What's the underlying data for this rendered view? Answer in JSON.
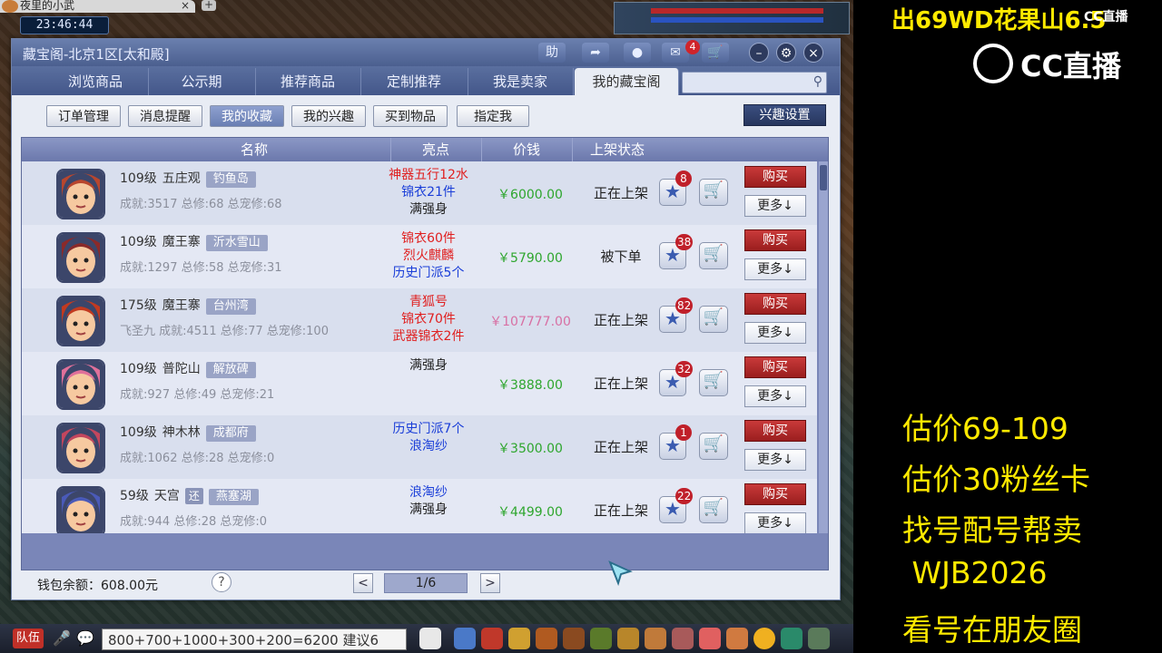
{
  "browser_tab": {
    "title": "夜里的小武",
    "close": "×",
    "new_tab": "+"
  },
  "clock": "23:46:44",
  "window": {
    "title": "藏宝阁-北京1区[太和殿]",
    "help_label": "助",
    "mail_badge": "4",
    "controls": {
      "minimize": "–",
      "settings": "⚙",
      "close": "×"
    }
  },
  "tabs": [
    {
      "label": "浏览商品",
      "active": false
    },
    {
      "label": "公示期",
      "active": false
    },
    {
      "label": "推荐商品",
      "active": false
    },
    {
      "label": "定制推荐",
      "active": false
    },
    {
      "label": "我是卖家",
      "active": false
    },
    {
      "label": "我的藏宝阁",
      "active": true
    }
  ],
  "sub_buttons": [
    {
      "label": "订单管理",
      "active": false
    },
    {
      "label": "消息提醒",
      "active": false
    },
    {
      "label": "我的收藏",
      "active": true
    },
    {
      "label": "我的兴趣",
      "active": false
    },
    {
      "label": "买到物品",
      "active": false
    },
    {
      "label": "指定我",
      "active": false
    }
  ],
  "interest_settings_label": "兴趣设置",
  "columns": [
    "名称",
    "亮点",
    "价钱",
    "上架状态"
  ],
  "buy_label": "购买",
  "more_label": "更多↓",
  "rows": [
    {
      "level": "109级",
      "school": "五庄观",
      "server": "钓鱼岛",
      "tag": "",
      "stats": "成就:3517 总修:68 总宠修:68",
      "highlights": [
        {
          "text": "神器五行12水",
          "color": "red"
        },
        {
          "text": "锦衣21件",
          "color": "blue"
        },
        {
          "text": "满强身",
          "color": "black"
        }
      ],
      "price": "￥6000.00",
      "price_color": "green",
      "status": "正在上架",
      "fav_count": "8"
    },
    {
      "level": "109级",
      "school": "魔王寨",
      "server": "沂水雪山",
      "tag": "",
      "stats": "成就:1297 总修:58 总宠修:31",
      "highlights": [
        {
          "text": "锦衣60件",
          "color": "red"
        },
        {
          "text": "烈火麒麟",
          "color": "red"
        },
        {
          "text": "历史门派5个",
          "color": "blue"
        }
      ],
      "price": "￥5790.00",
      "price_color": "green",
      "status": "被下单",
      "fav_count": "38"
    },
    {
      "level": "175级",
      "school": "魔王寨",
      "server": "台州湾",
      "tag": "",
      "stats": "飞圣九 成就:4511 总修:77 总宠修:100",
      "highlights": [
        {
          "text": "青狐号",
          "color": "red"
        },
        {
          "text": "锦衣70件",
          "color": "red"
        },
        {
          "text": "武器锦衣2件",
          "color": "red"
        }
      ],
      "price": "￥107777.00",
      "price_color": "pink",
      "status": "正在上架",
      "fav_count": "82"
    },
    {
      "level": "109级",
      "school": "普陀山",
      "server": "解放碑",
      "tag": "",
      "stats": "成就:927 总修:49 总宠修:21",
      "highlights": [
        {
          "text": "满强身",
          "color": "black"
        }
      ],
      "price": "￥3888.00",
      "price_color": "green",
      "status": "正在上架",
      "fav_count": "32"
    },
    {
      "level": "109级",
      "school": "神木林",
      "server": "成都府",
      "tag": "",
      "stats": "成就:1062 总修:28 总宠修:0",
      "highlights": [
        {
          "text": "历史门派7个",
          "color": "blue"
        },
        {
          "text": "浪淘纱",
          "color": "blue"
        }
      ],
      "price": "￥3500.00",
      "price_color": "green",
      "status": "正在上架",
      "fav_count": "1"
    },
    {
      "level": "59级",
      "school": "天宫",
      "server": "燕塞湖",
      "tag": "还",
      "stats": "成就:944 总修:28 总宠修:0",
      "highlights": [
        {
          "text": "浪淘纱",
          "color": "blue"
        },
        {
          "text": "满强身",
          "color": "black"
        }
      ],
      "price": "￥4499.00",
      "price_color": "green",
      "status": "正在上架",
      "fav_count": "22"
    }
  ],
  "footer": {
    "wallet": "钱包余额：608.00元",
    "help": "?",
    "prev": "<",
    "page": "1/6",
    "next": ">"
  },
  "chat": {
    "team_label": "队伍",
    "input_text": "800+700+1000+300+200=6200   建议6"
  },
  "stream": {
    "headline": "出69WD花果山6.5",
    "cc_brand": "CC直播",
    "cc_small": "CC直播",
    "notes": [
      "估价69-109",
      "估价30粉丝卡",
      "找号配号帮卖",
      " WJB2026",
      "看号在朋友圈"
    ]
  },
  "avatar_colors": [
    "#b8462e",
    "#8a2a2a",
    "#c23a20",
    "#e0709a",
    "#c2465e",
    "#4a5ab8"
  ]
}
